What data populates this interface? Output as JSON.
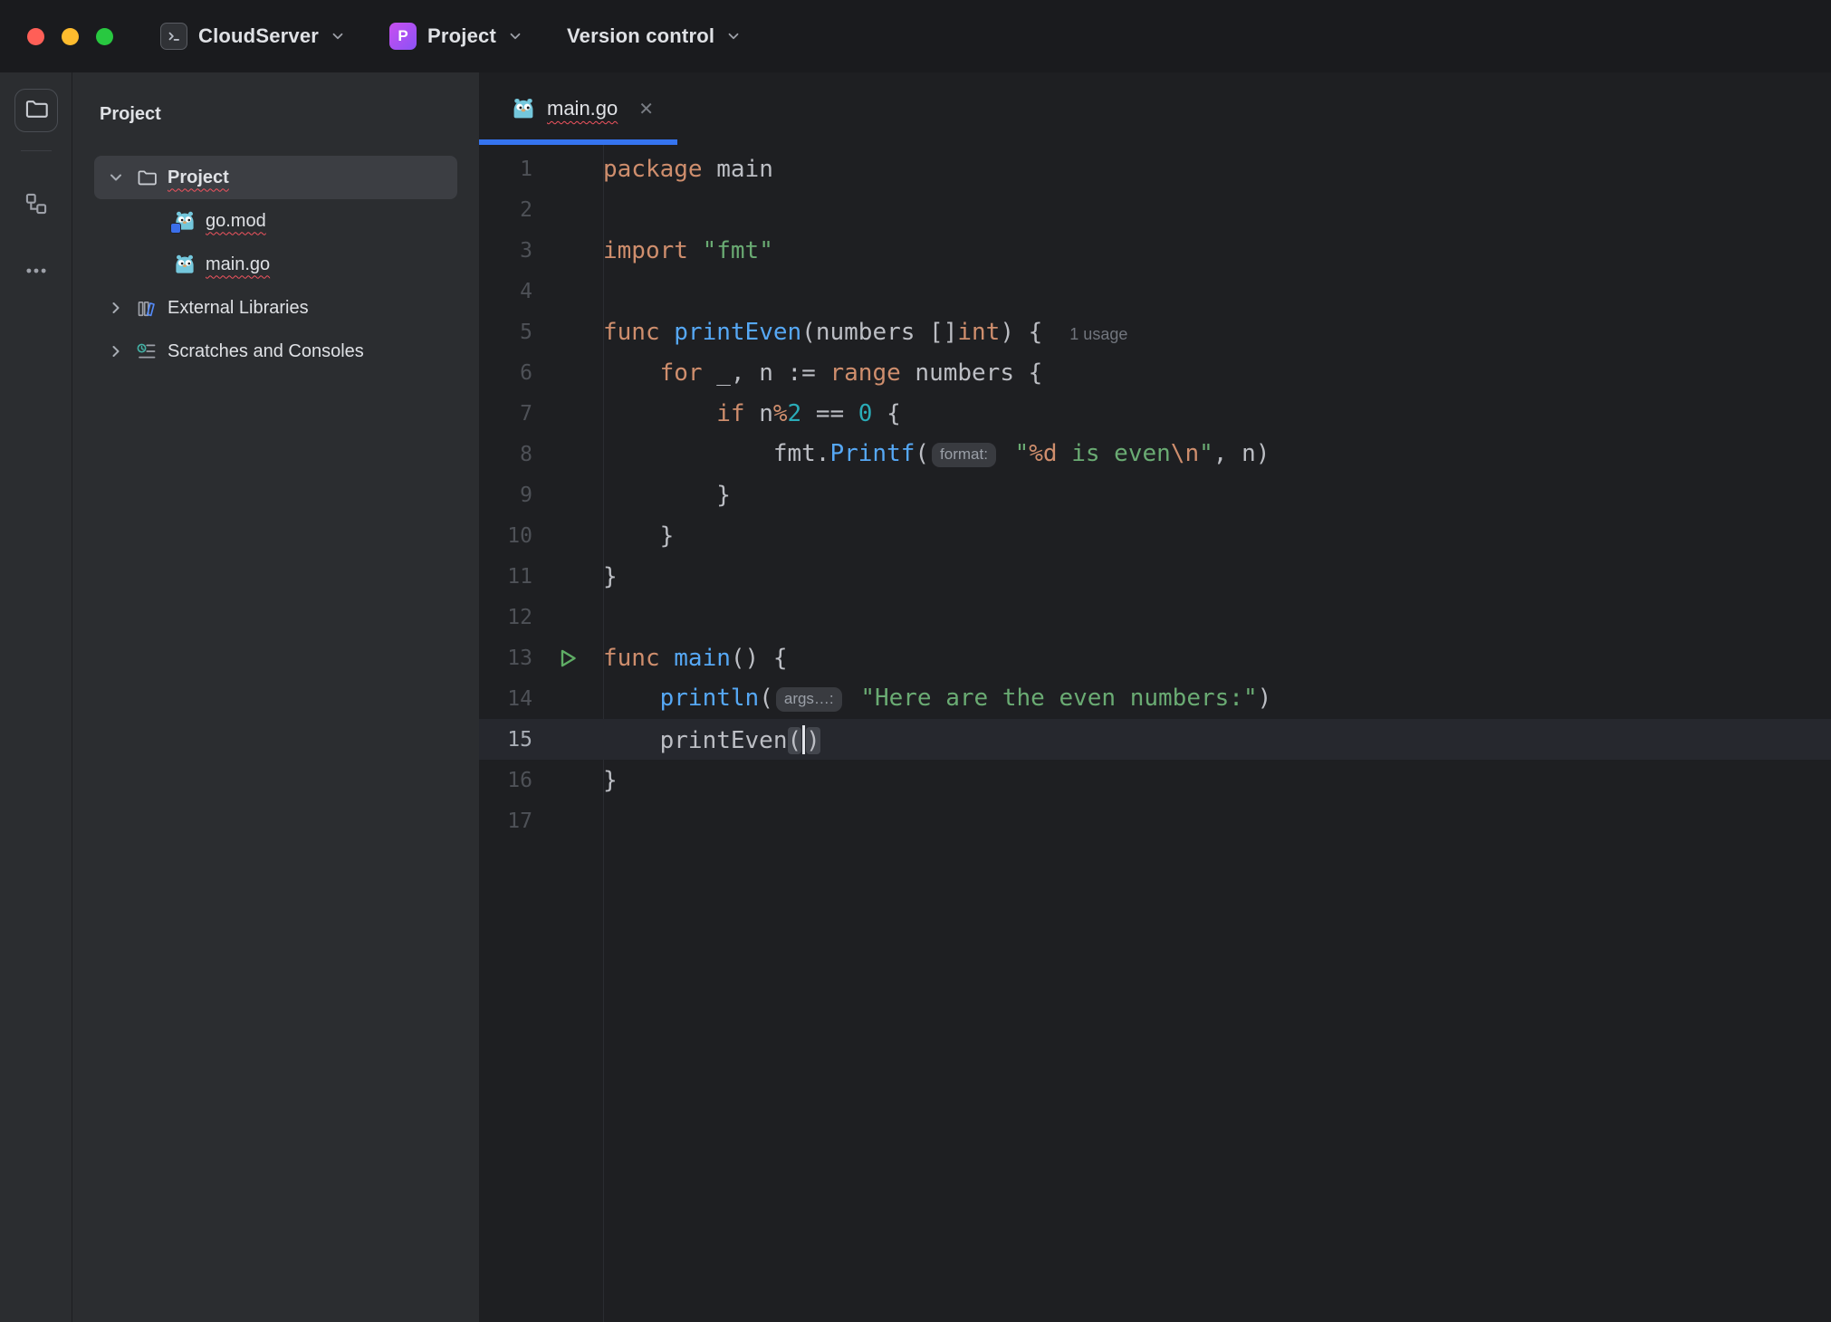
{
  "titlebar": {
    "menus": {
      "cloudserver": "CloudServer",
      "project": "Project",
      "version_control": "Version control"
    },
    "project_badge": "P"
  },
  "sidebar": {
    "header": "Project",
    "items": [
      {
        "label": "Project"
      },
      {
        "label": "go.mod"
      },
      {
        "label": "main.go"
      },
      {
        "label": "External Libraries"
      },
      {
        "label": "Scratches and Consoles"
      }
    ]
  },
  "editor": {
    "tab": {
      "label": "main.go",
      "close_icon": "✕"
    },
    "lines": [
      {
        "n": 1,
        "segs": [
          [
            "kw",
            "package"
          ],
          [
            "def",
            " main"
          ]
        ]
      },
      {
        "n": 2,
        "segs": []
      },
      {
        "n": 3,
        "segs": [
          [
            "kw",
            "import"
          ],
          [
            "def",
            " "
          ],
          [
            "str",
            "\"fmt\""
          ]
        ]
      },
      {
        "n": 4,
        "segs": []
      },
      {
        "n": 5,
        "segs": [
          [
            "kw",
            "func"
          ],
          [
            "def",
            " "
          ],
          [
            "fn",
            "printEven"
          ],
          [
            "def",
            "(numbers []"
          ],
          [
            "kw",
            "int"
          ],
          [
            "def",
            ") {"
          ],
          [
            "usage",
            "1 usage"
          ]
        ]
      },
      {
        "n": 6,
        "segs": [
          [
            "def",
            "    "
          ],
          [
            "kw",
            "for"
          ],
          [
            "def",
            " _, n := "
          ],
          [
            "kw",
            "range"
          ],
          [
            "def",
            " numbers {"
          ]
        ]
      },
      {
        "n": 7,
        "segs": [
          [
            "def",
            "        "
          ],
          [
            "kw",
            "if"
          ],
          [
            "def",
            " n"
          ],
          [
            "kw",
            "%"
          ],
          [
            "num",
            "2"
          ],
          [
            "def",
            " == "
          ],
          [
            "num",
            "0"
          ],
          [
            "def",
            " {"
          ]
        ]
      },
      {
        "n": 8,
        "segs": [
          [
            "def",
            "            fmt."
          ],
          [
            "fn",
            "Printf"
          ],
          [
            "def",
            "("
          ],
          [
            "hint",
            "format:"
          ],
          [
            "def",
            " "
          ],
          [
            "str",
            "\""
          ],
          [
            "esc",
            "%d"
          ],
          [
            "str",
            " is even"
          ],
          [
            "esc",
            "\\n"
          ],
          [
            "str",
            "\""
          ],
          [
            "def",
            ", n)"
          ]
        ]
      },
      {
        "n": 9,
        "segs": [
          [
            "def",
            "        }"
          ]
        ]
      },
      {
        "n": 10,
        "segs": [
          [
            "def",
            "    }"
          ]
        ]
      },
      {
        "n": 11,
        "segs": [
          [
            "def",
            "}"
          ]
        ]
      },
      {
        "n": 12,
        "segs": []
      },
      {
        "n": 13,
        "run": true,
        "segs": [
          [
            "kw",
            "func"
          ],
          [
            "def",
            " "
          ],
          [
            "fn",
            "main"
          ],
          [
            "def",
            "() {"
          ]
        ]
      },
      {
        "n": 14,
        "segs": [
          [
            "def",
            "    "
          ],
          [
            "fn",
            "println"
          ],
          [
            "def",
            "("
          ],
          [
            "hint",
            "args…:"
          ],
          [
            "def",
            " "
          ],
          [
            "str",
            "\"Here are the even numbers:\""
          ],
          [
            "def",
            ")"
          ]
        ]
      },
      {
        "n": 15,
        "cur": true,
        "segs": [
          [
            "def",
            "    printEven"
          ],
          [
            "phl",
            "("
          ],
          [
            "caret",
            ""
          ],
          [
            "phl",
            ")"
          ]
        ]
      },
      {
        "n": 16,
        "segs": [
          [
            "def",
            "}"
          ]
        ]
      },
      {
        "n": 17,
        "segs": []
      }
    ]
  },
  "colors": {
    "accent_blue": "#3574F0",
    "error_red": "#F2545F",
    "run_green": "#5FAD65",
    "keyword": "#CF8E6D",
    "function": "#56A8F5",
    "string": "#6AAB73",
    "number": "#2AACB8",
    "editor_bg": "#1E1F22",
    "panel_bg": "#2B2D30"
  }
}
